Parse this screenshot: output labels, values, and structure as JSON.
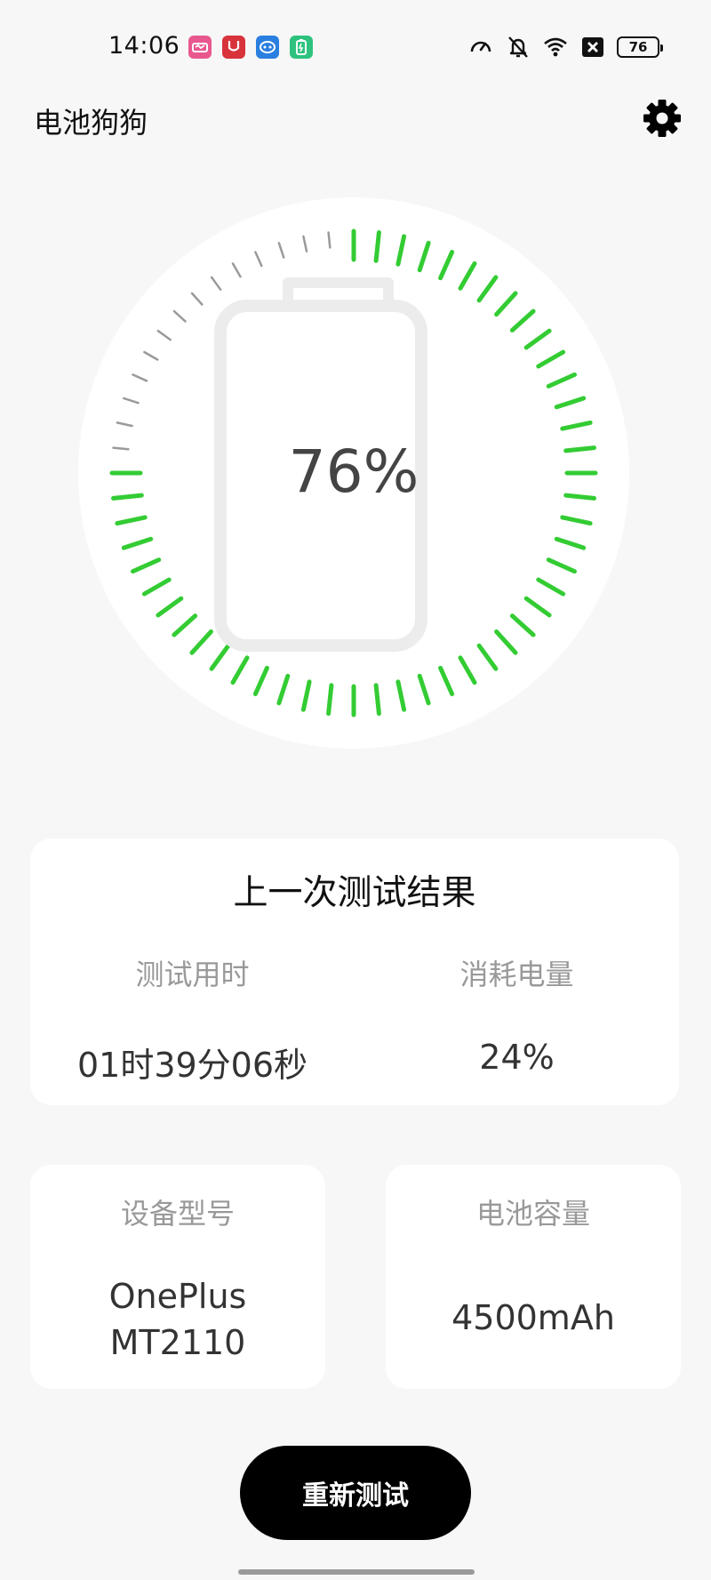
{
  "status_bar": {
    "time": "14:06",
    "battery_level": "76"
  },
  "app": {
    "title": "电池狗狗"
  },
  "gauge": {
    "percent_text": "76%",
    "level": 0.76,
    "active_color": "#33cc33",
    "inactive_color": "#9a9a9a"
  },
  "last_result": {
    "title": "上一次测试结果",
    "duration_label": "测试用时",
    "duration_value": "01时39分06秒",
    "consumed_label": "消耗电量",
    "consumed_value": "24%"
  },
  "device": {
    "label": "设备型号",
    "line1": "OnePlus",
    "line2": "MT2110"
  },
  "capacity": {
    "label": "电池容量",
    "value": "4500mAh"
  },
  "actions": {
    "retest_label": "重新测试"
  }
}
